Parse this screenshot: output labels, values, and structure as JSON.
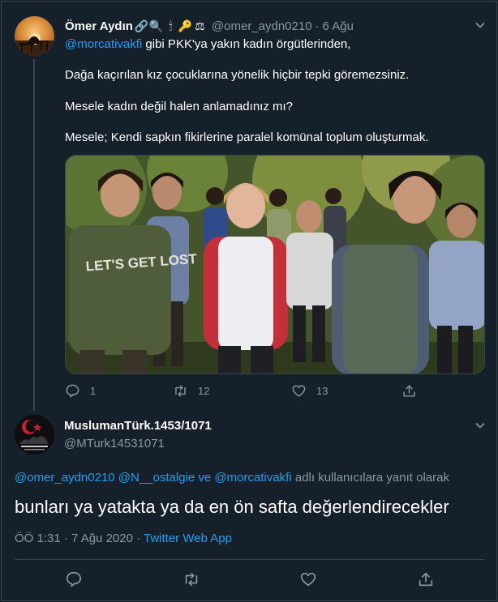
{
  "tweet1": {
    "display_name": "Ömer Aydın",
    "emojis": [
      "🔗",
      "🔍",
      "🕯",
      "🔑",
      "⚖"
    ],
    "emoji_icons": [
      "link-emoji",
      "magnifier-emoji",
      "candle-emoji",
      "key-emoji",
      "scales-emoji"
    ],
    "handle": "@omer_aydn0210",
    "dot": "·",
    "time": "6 Ağu",
    "line1_mention": "@morcativakfi",
    "line1_rest": " gibi  PKK'ya yakın kadın örgütlerinden,",
    "line2": "Dağa kaçırılan kız çocuklarına yönelik hiçbir tepki göremezsiniz.",
    "line3": "Mesele kadın değil halen anlamadınız mı?",
    "line4": " Mesele; Kendi sapkın fikirlerine paralel komünal toplum oluşturmak.",
    "photo_shirt_text": "LET'S GET LOST",
    "replies": "1",
    "retweets": "12",
    "likes": "13"
  },
  "tweet2": {
    "display_name": "MuslumanTürk.1453/1071",
    "handle": "@MTurk14531071",
    "reply_mentions": "@omer_aydn0210 @N__ostalgie ve @morcativakfi",
    "reply_suffix": " adlı kullanıcılara yanıt olarak",
    "text": "bunları ya yatakta ya da en ön safta değerlendirecekler",
    "time": "ÖÖ 1:31 · 7 Ağu 2020",
    "sep": " · ",
    "source": "Twitter Web App"
  },
  "colors": {
    "background": "#15202b",
    "border": "#38444d",
    "secondary_text": "#8899a6",
    "link": "#1da1f2"
  }
}
